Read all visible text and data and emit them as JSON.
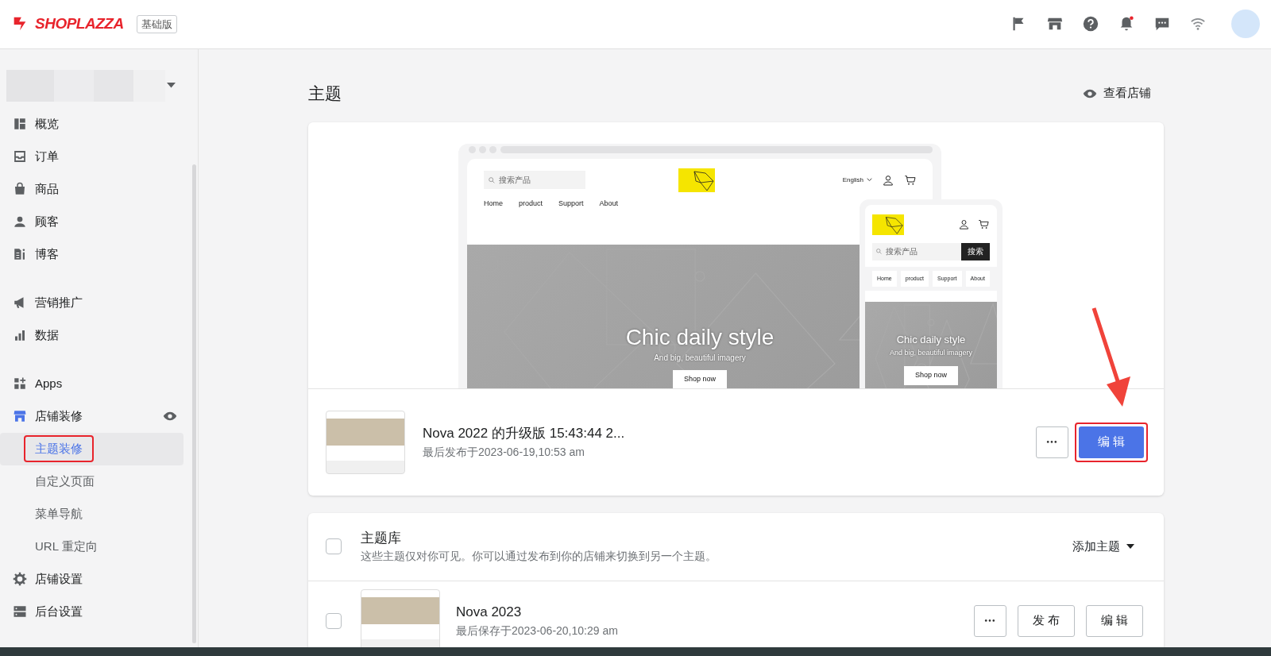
{
  "header": {
    "logo": "SHOPLAZZA",
    "plan_badge": "基础版",
    "notification_unread": true
  },
  "sidebar": {
    "sections": [
      {
        "items": [
          {
            "label": "概览",
            "selected": false
          },
          {
            "label": "订单",
            "selected": false
          },
          {
            "label": "商品",
            "selected": false
          },
          {
            "label": "顾客",
            "selected": false
          },
          {
            "label": "博客",
            "selected": false
          }
        ]
      },
      {
        "items": [
          {
            "label": "营销推广",
            "selected": false
          },
          {
            "label": "数据",
            "selected": false
          }
        ]
      },
      {
        "items": [
          {
            "label": "Apps",
            "selected": false
          },
          {
            "label": "店铺装修",
            "selected": false,
            "expanded": true,
            "active": true,
            "preview_icon": true,
            "children": [
              {
                "label": "主题装修",
                "selected": true,
                "highlighted": true
              },
              {
                "label": "自定义页面",
                "selected": false,
                "highlighted": false
              },
              {
                "label": "菜单导航",
                "selected": false,
                "highlighted": false
              },
              {
                "label": "URL 重定向",
                "selected": false,
                "highlighted": false
              }
            ]
          },
          {
            "label": "店铺设置",
            "selected": false
          },
          {
            "label": "后台设置",
            "selected": false
          }
        ]
      }
    ]
  },
  "page": {
    "title": "主题",
    "view_store": "查看店铺"
  },
  "preview": {
    "desktop": {
      "search_placeholder": "搜索产品",
      "language": "English",
      "nav": [
        "Home",
        "product",
        "Support",
        "About"
      ],
      "hero_title": "Chic daily style",
      "hero_subtitle": "And big, beautiful imagery",
      "cta": "Shop now"
    },
    "mobile": {
      "search_placeholder": "搜索产品",
      "search_button": "搜索",
      "nav": [
        "Home",
        "product",
        "Support",
        "About"
      ],
      "hero_title": "Chic daily style",
      "hero_subtitle": "And big, beautiful imagery",
      "cta": "Shop now"
    }
  },
  "current_theme": {
    "name": "Nova 2022 的升级版 15:43:44 2...",
    "published": "最后发布于2023-06-19,10:53 am",
    "edit_label": "编 辑",
    "edit_highlighted": true
  },
  "library": {
    "title": "主题库",
    "description": "这些主题仅对你可见。你可以通过发布到你的店铺来切换到另一个主题。",
    "checked": false,
    "add_label": "添加主题",
    "themes": [
      {
        "name": "Nova 2023",
        "saved": "最后保存于2023-06-20,10:29 am",
        "checked": false,
        "publish_label": "发 布",
        "edit_label": "编 辑"
      }
    ]
  }
}
